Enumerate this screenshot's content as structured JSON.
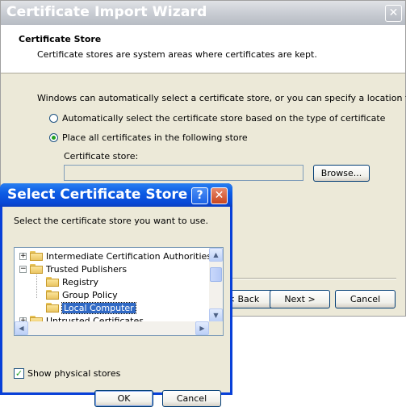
{
  "wizard": {
    "title": "Certificate Import Wizard",
    "close_glyph": "✕",
    "header_title": "Certificate Store",
    "header_subtitle": "Certificate stores are system areas where certificates are kept.",
    "intro_text": "Windows can automatically select a certificate store, or you can specify a location for",
    "radio_auto_label": "Automatically select the certificate store based on the type of certificate",
    "radio_manual_label": "Place all certificates in the following store",
    "selected_option": "manual",
    "store_label": "Certificate store:",
    "store_value": "",
    "browse_label": "Browse...",
    "back_label": "< Back",
    "next_label": "Next >",
    "cancel_label": "Cancel"
  },
  "dialog": {
    "title": "Select Certificate Store",
    "help_glyph": "?",
    "close_glyph": "✕",
    "prompt": "Select the certificate store you want to use.",
    "tree": [
      {
        "label": "Intermediate Certification Authorities",
        "expander": "+",
        "selected": false
      },
      {
        "label": "Trusted Publishers",
        "expander": "−",
        "selected": false
      },
      {
        "label": "Registry",
        "expander": "",
        "selected": false
      },
      {
        "label": "Group Policy",
        "expander": "",
        "selected": false
      },
      {
        "label": "Local Computer",
        "expander": "",
        "selected": true
      },
      {
        "label": "Untrusted Certificates",
        "expander": "+",
        "selected": false
      }
    ],
    "show_physical_label": "Show physical stores",
    "show_physical_checked": true,
    "ok_label": "OK",
    "cancel_label": "Cancel",
    "scroll_up": "▲",
    "scroll_down": "▼",
    "scroll_left": "◀",
    "scroll_right": "▶"
  }
}
